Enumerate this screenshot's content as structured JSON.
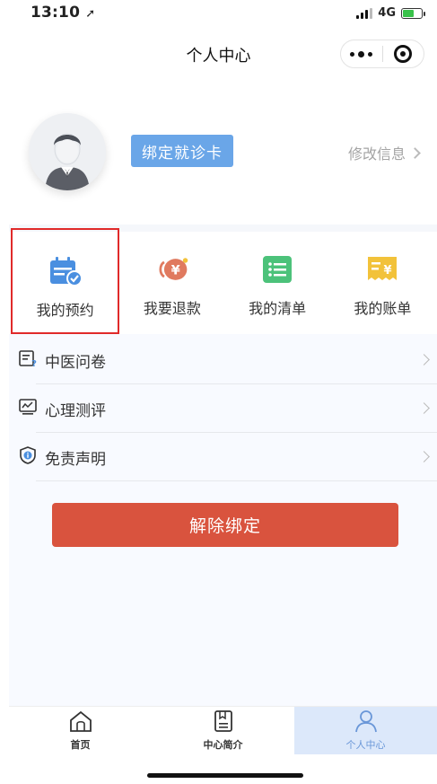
{
  "status": {
    "time": "13:10",
    "network": "4G"
  },
  "nav": {
    "title": "个人中心"
  },
  "profile": {
    "bind_card_label": "绑定就诊卡",
    "edit_info_label": "修改信息"
  },
  "quick_actions": [
    {
      "label": "我的预约",
      "icon": "calendar-check-icon",
      "color": "#4a8fe0"
    },
    {
      "label": "我要退款",
      "icon": "refund-yen-icon",
      "color": "#e07a5f"
    },
    {
      "label": "我的清单",
      "icon": "list-icon",
      "color": "#4cc27a"
    },
    {
      "label": "我的账单",
      "icon": "bill-yen-icon",
      "color": "#f2c23a"
    }
  ],
  "menu": [
    {
      "label": "中医问卷",
      "icon": "questionnaire-icon"
    },
    {
      "label": "心理测评",
      "icon": "monitor-chart-icon"
    },
    {
      "label": "免责声明",
      "icon": "shield-info-icon"
    }
  ],
  "unbind_label": "解除绑定",
  "tabs": [
    {
      "label": "首页",
      "icon": "home-icon"
    },
    {
      "label": "中心简介",
      "icon": "book-icon"
    },
    {
      "label": "个人中心",
      "icon": "person-icon",
      "active": true
    }
  ],
  "colors": {
    "accent": "#6aa6e8",
    "danger": "#d9533e",
    "tab_active": "#6a97d8"
  }
}
